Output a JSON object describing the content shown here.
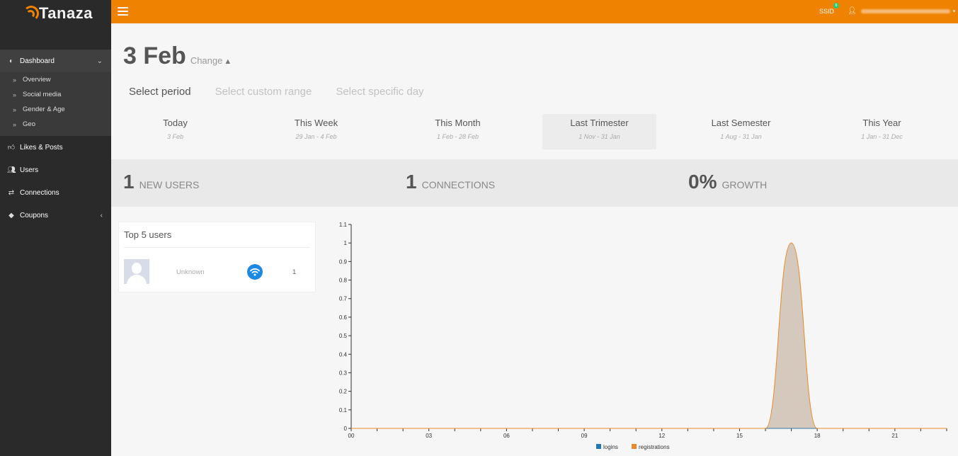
{
  "brand": {
    "name": "Tanaza",
    "accent": "#ef8200",
    "sidebar_bg": "#2a2a2a"
  },
  "topbar": {
    "ssid_label": "SSID",
    "ssid_badge": "6"
  },
  "sidebar": {
    "dashboard": {
      "label": "Dashboard",
      "icon": "dashboard-icon"
    },
    "dashboard_items": [
      {
        "label": "Overview"
      },
      {
        "label": "Social media"
      },
      {
        "label": "Gender & Age"
      },
      {
        "label": "Geo"
      }
    ],
    "items": [
      {
        "label": "Likes & Posts",
        "icon": "thumbs-up-icon"
      },
      {
        "label": "Users",
        "icon": "users-icon"
      },
      {
        "label": "Connections",
        "icon": "exchange-icon"
      },
      {
        "label": "Coupons",
        "icon": "tag-icon"
      }
    ]
  },
  "header": {
    "date": "3 Feb",
    "change_label": "Change"
  },
  "period_tabs": [
    {
      "label": "Select period",
      "active": true
    },
    {
      "label": "Select custom range",
      "active": false
    },
    {
      "label": "Select specific day",
      "active": false
    }
  ],
  "ranges": [
    {
      "label": "Today",
      "sub": "3 Feb"
    },
    {
      "label": "This Week",
      "sub": "29 Jan - 4 Feb"
    },
    {
      "label": "This Month",
      "sub": "1 Feb - 28 Feb"
    },
    {
      "label": "Last Trimester",
      "sub": "1 Nov - 31 Jan"
    },
    {
      "label": "Last Semester",
      "sub": "1 Aug - 31 Jan"
    },
    {
      "label": "This Year",
      "sub": "1 Jan - 31 Dec"
    }
  ],
  "stats": [
    {
      "value": "1",
      "label": "New users"
    },
    {
      "value": "1",
      "label": "Connections"
    },
    {
      "value": "0%",
      "label": "Growth"
    }
  ],
  "top_users": {
    "title": "Top 5 users",
    "rows": [
      {
        "name": "Unknown",
        "count": "1"
      }
    ]
  },
  "chart_data": {
    "type": "area",
    "title": "",
    "xlabel": "",
    "ylabel": "",
    "x_ticks": [
      "00",
      "03",
      "06",
      "09",
      "12",
      "15",
      "18",
      "21"
    ],
    "xlim": [
      0,
      23
    ],
    "ylim": [
      0,
      1.1
    ],
    "y_ticks": [
      "0",
      "0.1",
      "0.2",
      "0.3",
      "0.4",
      "0.5",
      "0.6",
      "0.7",
      "0.8",
      "0.9",
      "1",
      "1.1"
    ],
    "x": [
      0,
      15,
      16,
      17,
      18,
      19,
      23
    ],
    "series": [
      {
        "name": "logins",
        "color": "#1f77b4",
        "values": [
          0,
          0,
          0,
          0,
          0,
          0,
          0
        ]
      },
      {
        "name": "registrations",
        "color": "#e8892b",
        "values": [
          0,
          0,
          0,
          1,
          0,
          0,
          0
        ]
      }
    ],
    "legend_position": "bottom-center",
    "grid": false
  }
}
